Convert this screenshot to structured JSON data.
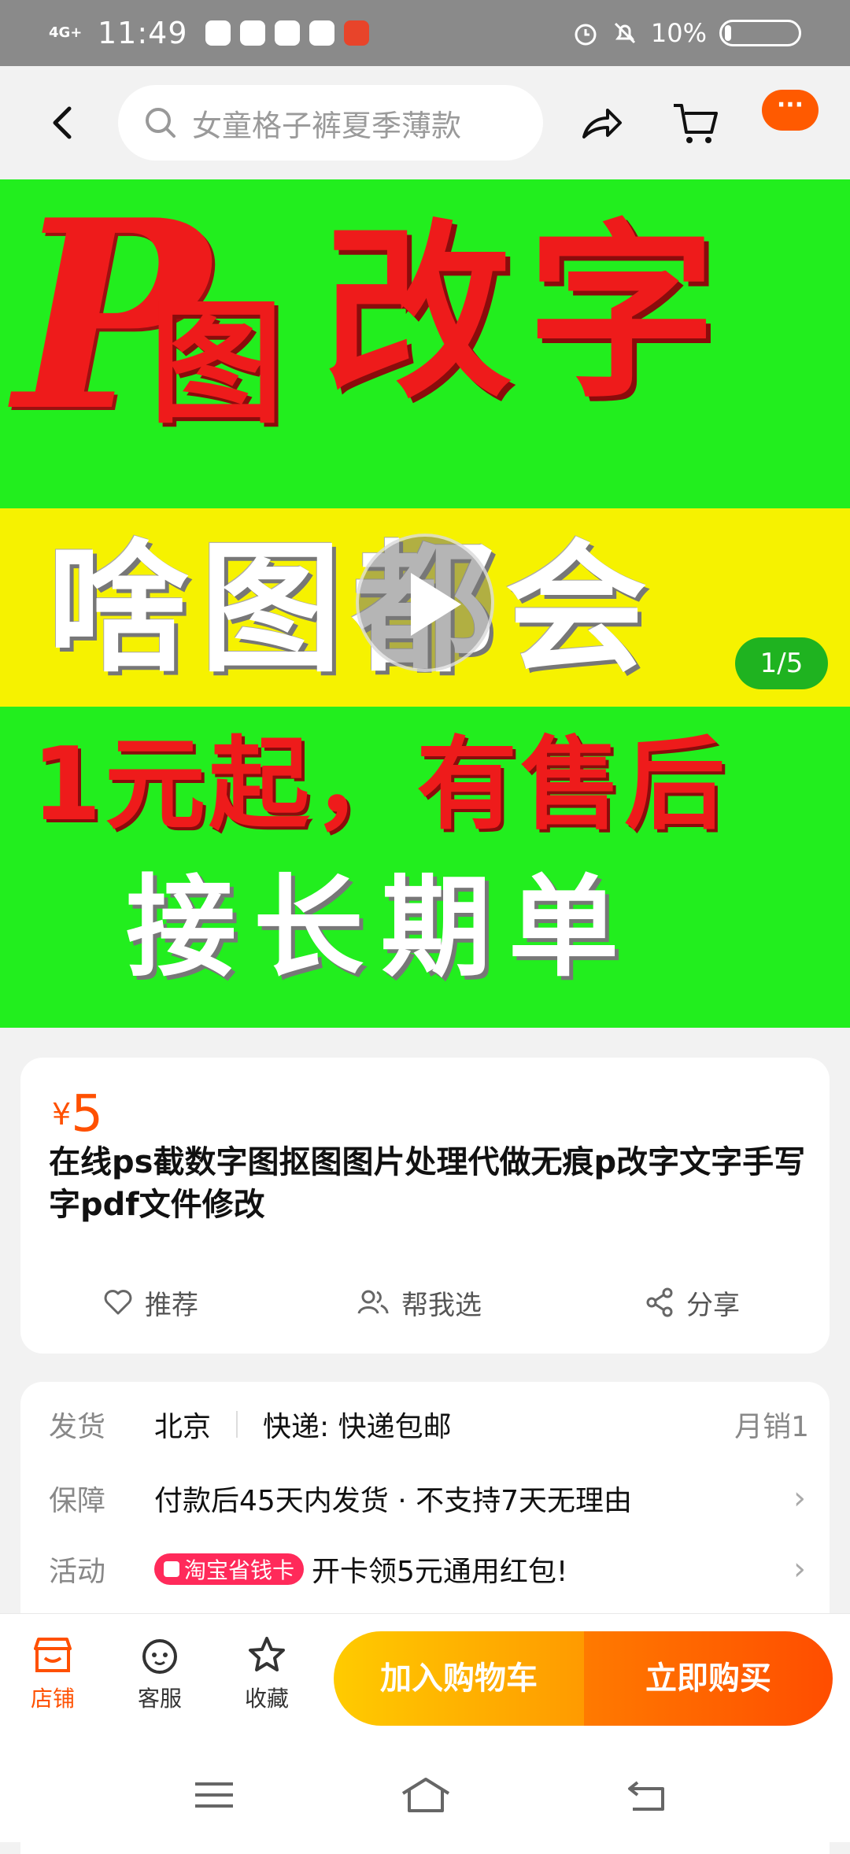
{
  "status_bar": {
    "network": "4G+",
    "time": "11:49",
    "battery": "10%"
  },
  "header": {
    "search_placeholder": "女童格子裤夏季薄款",
    "more_label": "···"
  },
  "banner": {
    "line1_p": "P",
    "line1_tu": "图",
    "line1_rest": "改字",
    "line2": "啥图都会",
    "line3": "1元起，有售后",
    "line4": "接长期单",
    "page_indicator": "1/5"
  },
  "product": {
    "currency": "¥",
    "price": "5",
    "title": "在线ps截数字图抠图图片处理代做无痕p改字文字手写字pdf文件修改",
    "actions": {
      "recommend": "推荐",
      "help_choose": "帮我选",
      "share": "分享"
    }
  },
  "info": {
    "shipping_label": "发货",
    "shipping_from": "北京",
    "shipping_method": "快递: 快递包邮",
    "monthly_sales": "月销1",
    "guarantee_label": "保障",
    "guarantee_text": "付款后45天内发货 · 不支持7天无理由",
    "promo_label": "活动",
    "promo_badge": "淘宝省钱卡",
    "promo_text": "开卡领5元通用红包!"
  },
  "bottom_bar": {
    "shop": "店铺",
    "service": "客服",
    "favorite": "收藏",
    "add_to_cart": "加入购物车",
    "buy_now": "立即购买"
  },
  "colors": {
    "accent": "#ff5000",
    "banner_green": "#22ee1e",
    "banner_yellow": "#f6f200",
    "banner_red": "#ee1b1b"
  }
}
